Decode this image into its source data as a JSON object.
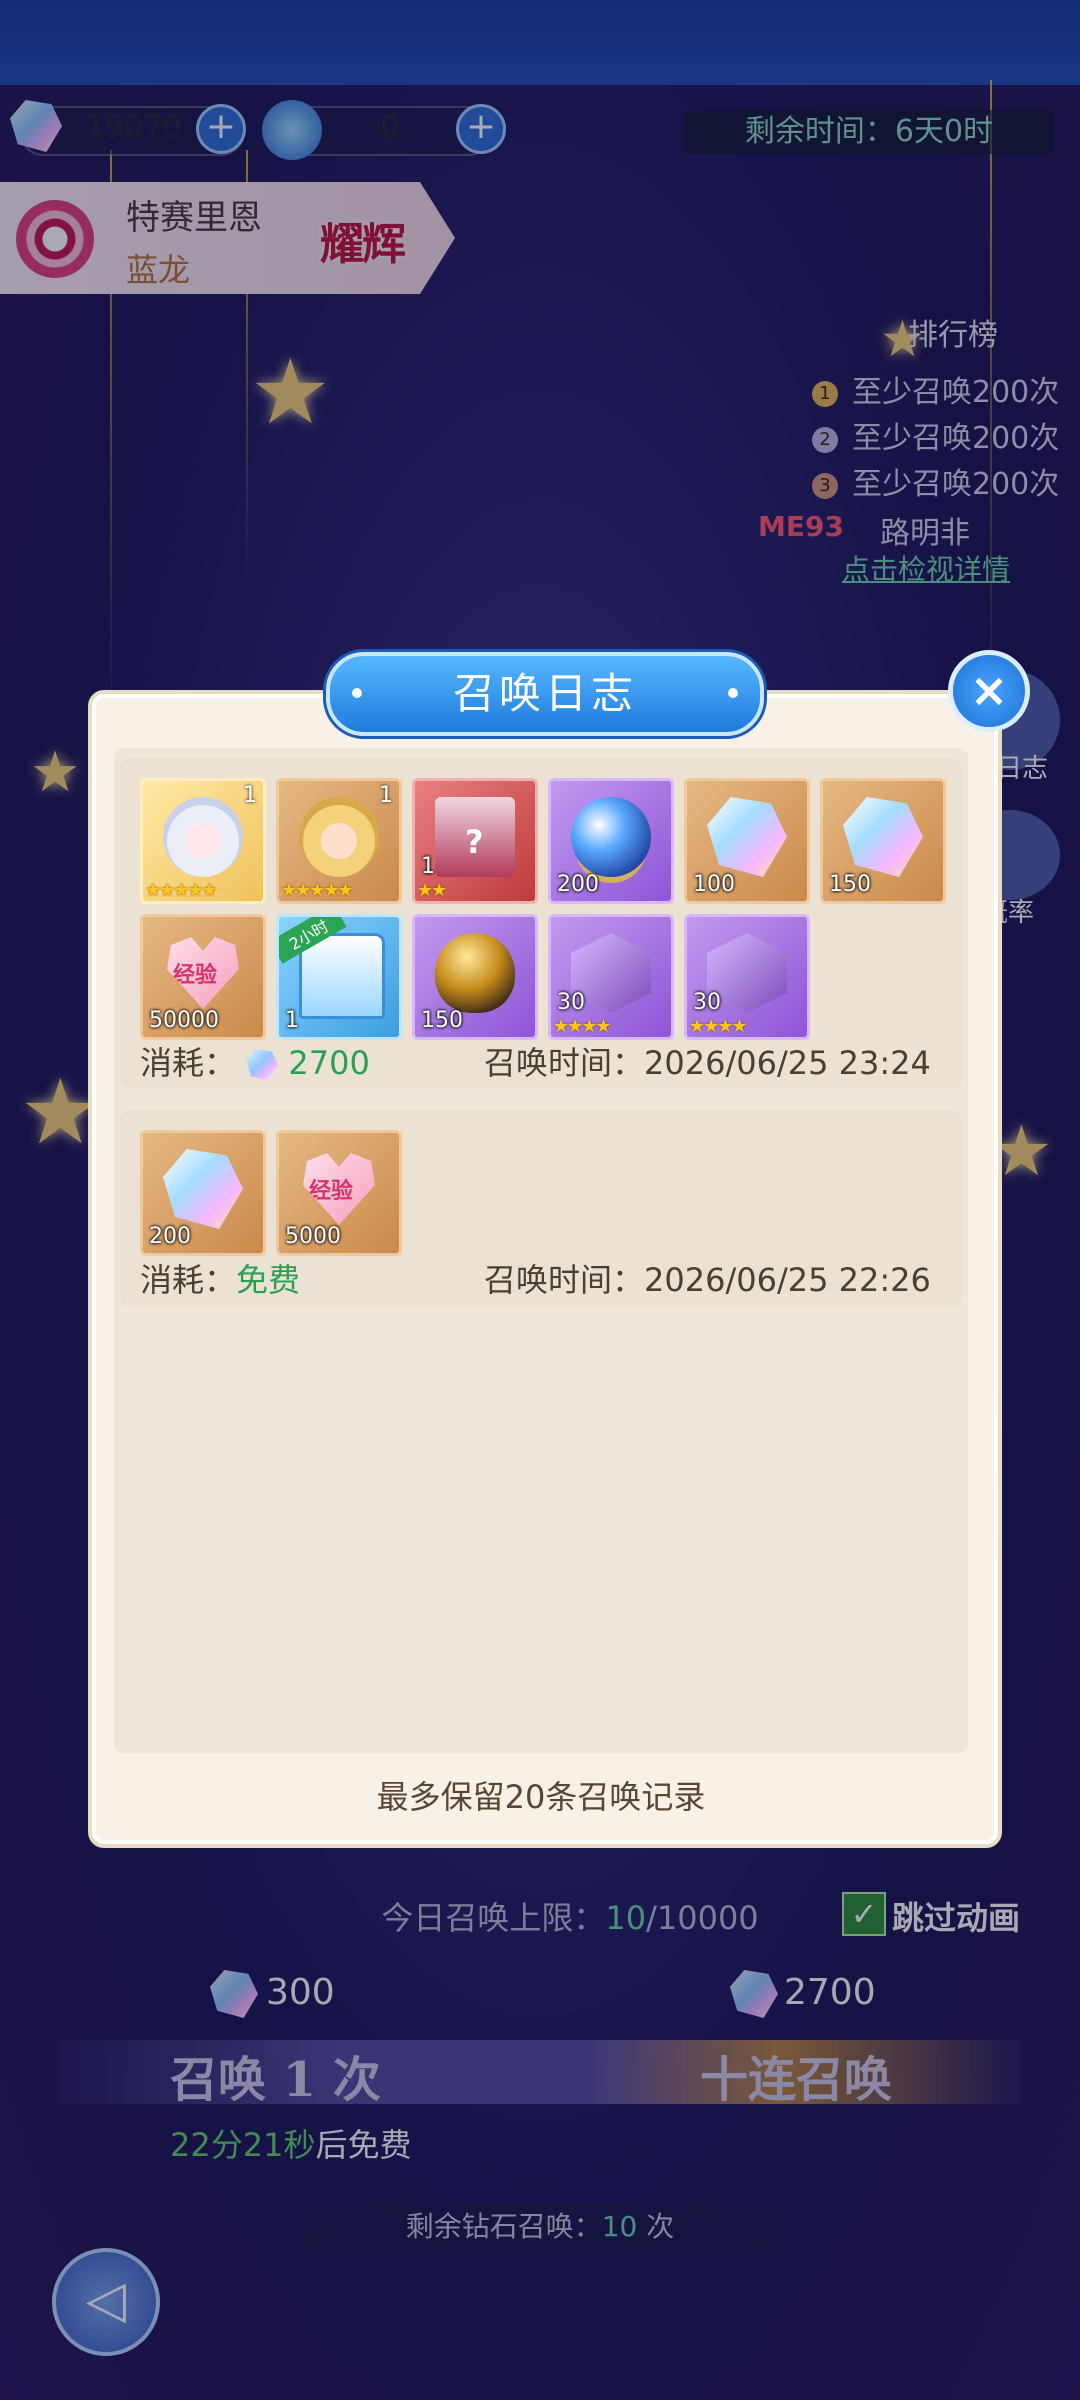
{
  "currency": {
    "diamonds": "19070",
    "tickets": "0",
    "plus_label": "+"
  },
  "timer": "剩余时间：6天0时",
  "character": {
    "name": "特赛里恩",
    "type": "蓝龙",
    "badge": "耀辉"
  },
  "ranking": {
    "title": "排行榜",
    "items": [
      {
        "rank": "1",
        "text": "至少召唤200次"
      },
      {
        "rank": "2",
        "text": "至少召唤200次"
      },
      {
        "rank": "3",
        "text": "至少召唤200次"
      }
    ],
    "me_label": "ME",
    "me_rank": "93",
    "me_name": "路明非",
    "detail_link": "点击检视详情"
  },
  "side_buttons": {
    "log": "日志",
    "rate": "概率"
  },
  "modal": {
    "title": "召唤日志",
    "close_icon": "×",
    "records": [
      {
        "cost_label": "消耗：",
        "cost_value": "2700",
        "time_label": "召唤时间：",
        "time_value": "2026/06/25 23:24",
        "items": [
          {
            "kind": "hero-card",
            "count": "",
            "corner": "1",
            "stars": "★★★★★"
          },
          {
            "kind": "hero-card",
            "count": "",
            "corner": "1",
            "stars": "★★★★★"
          },
          {
            "kind": "random-box",
            "count": "1",
            "corner": "",
            "stars": "★★"
          },
          {
            "kind": "crystal-orb",
            "count": "200",
            "corner": "",
            "stars": ""
          },
          {
            "kind": "diamond",
            "count": "100",
            "corner": "",
            "stars": ""
          },
          {
            "kind": "diamond",
            "count": "150",
            "corner": "",
            "stars": ""
          },
          {
            "kind": "exp-heart",
            "count": "50000",
            "corner": "",
            "stars": "",
            "label": "经验"
          },
          {
            "kind": "chest",
            "count": "1",
            "corner": "",
            "stars": "",
            "tag": "2小时"
          },
          {
            "kind": "golden-egg",
            "count": "150",
            "corner": "",
            "stars": ""
          },
          {
            "kind": "soul-cube",
            "count": "30",
            "corner": "",
            "stars": "★★★★"
          },
          {
            "kind": "soul-cube",
            "count": "30",
            "corner": "",
            "stars": "★★★★"
          }
        ]
      },
      {
        "cost_label": "消耗：",
        "cost_value": "免费",
        "time_label": "召唤时间：",
        "time_value": "2026/06/25 22:26",
        "items": [
          {
            "kind": "diamond",
            "count": "200",
            "corner": "",
            "stars": ""
          },
          {
            "kind": "exp-heart",
            "count": "5000",
            "corner": "",
            "stars": "",
            "label": "经验"
          }
        ]
      }
    ],
    "footer_note": "最多保留20条召唤记录"
  },
  "bottom": {
    "limit_label": "今日召唤上限：",
    "limit_used": "10",
    "limit_total": "/10000",
    "skip_label": "跳过动画",
    "skip_checked": true,
    "single_cost": "300",
    "ten_cost": "2700",
    "single_label": "召唤 1 次",
    "ten_label": "十连召唤",
    "free_time": "22分21秒",
    "free_suffix": "后免费",
    "remain_label": "剩余钻石召唤：",
    "remain_value": "10",
    "remain_unit": " 次",
    "back_icon": "◁"
  }
}
